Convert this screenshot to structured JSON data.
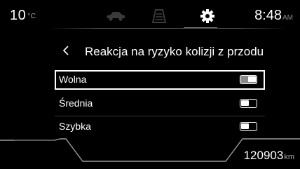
{
  "status_bar": {
    "temperature": "10",
    "temperature_unit": "°C",
    "time": "8:48",
    "time_period": "AM",
    "tabs": [
      {
        "icon": "car-icon"
      },
      {
        "icon": "road-lanes-icon"
      },
      {
        "icon": "gear-icon",
        "active": true
      }
    ]
  },
  "header": {
    "back_icon": "chevron-left-icon",
    "title": "Reakcja na ryzyko kolizji z przodu"
  },
  "options": [
    {
      "label": "Wolna",
      "selected": true,
      "state": "on"
    },
    {
      "label": "Średnia",
      "selected": false,
      "state": "off"
    },
    {
      "label": "Szybka",
      "selected": false,
      "state": "off"
    }
  ],
  "footer": {
    "odometer": "120903",
    "odometer_unit": "km"
  },
  "colors": {
    "background": "#000000",
    "text": "#ffffff",
    "dim_text": "#aaaaaa",
    "toggle_on_fill": "#8a8a8a"
  }
}
